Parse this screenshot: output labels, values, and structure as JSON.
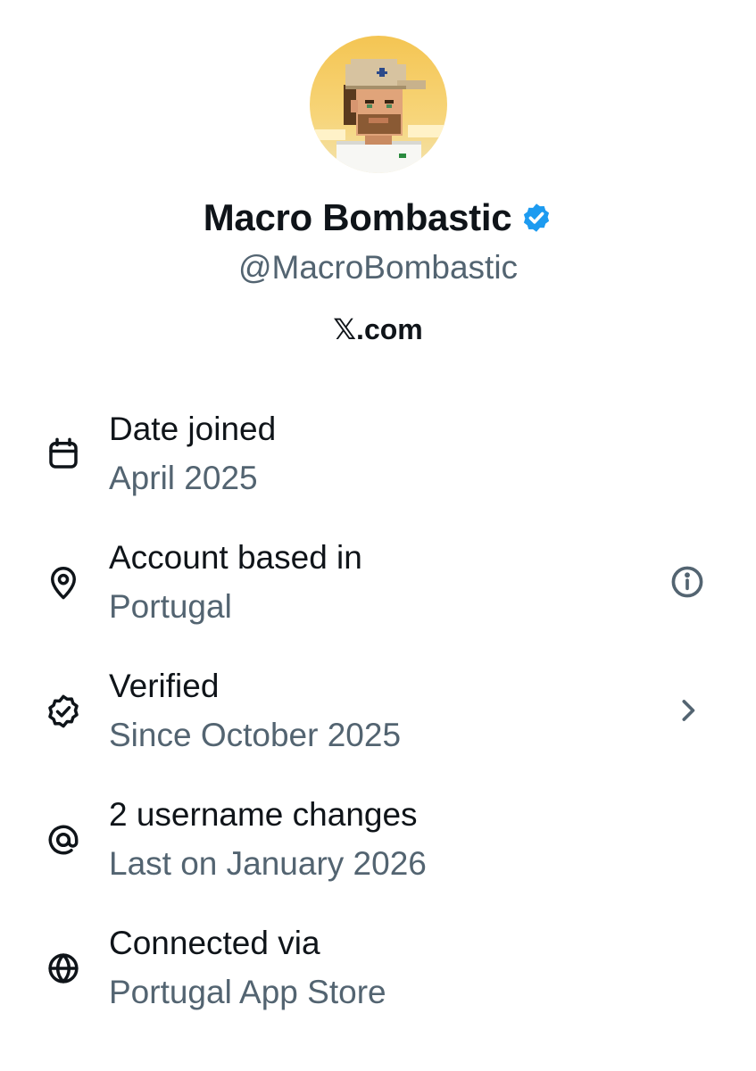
{
  "profile": {
    "display_name": "Macro Bombastic",
    "handle": "@MacroBombastic",
    "site": "𝕏.com",
    "avatar_icon": "pixel-art-avatar",
    "verified_icon": "verified-badge-icon",
    "verified_color": "#1d9bf0"
  },
  "about": {
    "rows": [
      {
        "icon": "calendar-icon",
        "title": "Date joined",
        "subtitle": "April 2025"
      },
      {
        "icon": "location-pin-icon",
        "title": "Account based in",
        "subtitle": "Portugal",
        "action_icon": "info-icon"
      },
      {
        "icon": "verified-check-icon",
        "title": "Verified",
        "subtitle": "Since October 2025",
        "action_icon": "chevron-right-icon"
      },
      {
        "icon": "at-sign-icon",
        "title": "2 username changes",
        "subtitle": "Last on January 2026"
      },
      {
        "icon": "globe-icon",
        "title": "Connected via",
        "subtitle": "Portugal App Store"
      }
    ]
  },
  "colors": {
    "primary_text": "#0f1419",
    "secondary_text": "#536471",
    "accent": "#1d9bf0"
  }
}
